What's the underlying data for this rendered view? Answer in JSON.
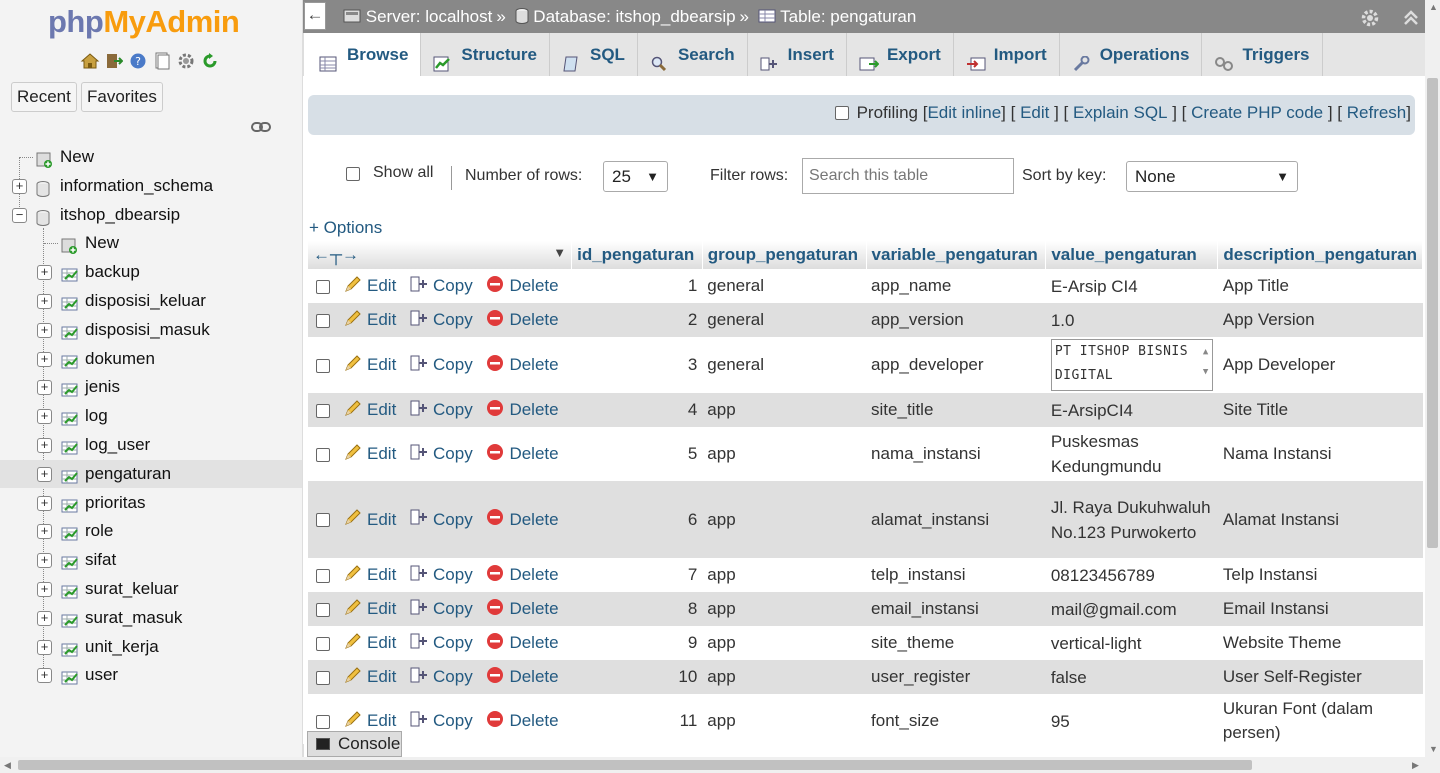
{
  "sidebar": {
    "logo_part1": "php",
    "logo_part2": "MyAdmin",
    "recent_label": "Recent",
    "favorites_label": "Favorites",
    "tree": [
      {
        "label": "New",
        "level": 0
      },
      {
        "label": "information_schema",
        "level": 0
      },
      {
        "label": "itshop_dbearsip",
        "level": 0
      },
      {
        "label": "New",
        "level": 1
      },
      {
        "label": "backup",
        "level": 1
      },
      {
        "label": "disposisi_keluar",
        "level": 1
      },
      {
        "label": "disposisi_masuk",
        "level": 1
      },
      {
        "label": "dokumen",
        "level": 1
      },
      {
        "label": "jenis",
        "level": 1
      },
      {
        "label": "log",
        "level": 1
      },
      {
        "label": "log_user",
        "level": 1
      },
      {
        "label": "pengaturan",
        "level": 1,
        "active": true
      },
      {
        "label": "prioritas",
        "level": 1
      },
      {
        "label": "role",
        "level": 1
      },
      {
        "label": "sifat",
        "level": 1
      },
      {
        "label": "surat_keluar",
        "level": 1
      },
      {
        "label": "surat_masuk",
        "level": 1
      },
      {
        "label": "unit_kerja",
        "level": 1
      },
      {
        "label": "user",
        "level": 1
      }
    ]
  },
  "breadcrumb": {
    "server": "Server: localhost",
    "database": "Database: itshop_dbearsip",
    "table": "Table: pengaturan",
    "sep": "»"
  },
  "tabs": [
    {
      "label": "Browse",
      "icon": "browse-icon",
      "active": true
    },
    {
      "label": "Structure",
      "icon": "structure-icon"
    },
    {
      "label": "SQL",
      "icon": "sql-icon"
    },
    {
      "label": "Search",
      "icon": "search-icon"
    },
    {
      "label": "Insert",
      "icon": "insert-icon"
    },
    {
      "label": "Export",
      "icon": "export-icon"
    },
    {
      "label": "Import",
      "icon": "import-icon"
    },
    {
      "label": "Operations",
      "icon": "operations-icon"
    },
    {
      "label": "Triggers",
      "icon": "triggers-icon"
    }
  ],
  "sqlbar": {
    "profiling": "Profiling",
    "links": [
      "Edit inline",
      "Edit",
      "Explain SQL",
      "Create PHP code",
      "Refresh"
    ]
  },
  "navbar": {
    "show_all": "Show all",
    "rows_label": "Number of rows:",
    "rows_value": "25",
    "filter_label": "Filter rows:",
    "filter_placeholder": "Search this table",
    "sort_label": "Sort by key:",
    "sort_value": "None"
  },
  "options_link": "+ Options",
  "table": {
    "columns": [
      "id_pengaturan",
      "group_pengaturan",
      "variable_pengaturan",
      "value_pengaturan",
      "description_pengaturan"
    ],
    "actions": {
      "edit": "Edit",
      "copy": "Copy",
      "delete": "Delete"
    },
    "rows": [
      {
        "id": "1",
        "group": "general",
        "variable": "app_name",
        "value": "E-Arsip CI4",
        "description": "App Title"
      },
      {
        "id": "2",
        "group": "general",
        "variable": "app_version",
        "value": "1.0",
        "description": "App Version"
      },
      {
        "id": "3",
        "group": "general",
        "variable": "app_developer",
        "value": "PT ITSHOP BISNIS DIGITAL",
        "description": "App Developer",
        "textarea": true
      },
      {
        "id": "4",
        "group": "app",
        "variable": "site_title",
        "value": "E-ArsipCI4",
        "description": "Site Title"
      },
      {
        "id": "5",
        "group": "app",
        "variable": "nama_instansi",
        "value": "Puskesmas Kedungmundu",
        "description": "Nama Instansi"
      },
      {
        "id": "6",
        "group": "app",
        "variable": "alamat_instansi",
        "value": "Jl. Raya Dukuhwaluh No.123 Purwokerto",
        "description": "Alamat Instansi"
      },
      {
        "id": "7",
        "group": "app",
        "variable": "telp_instansi",
        "value": "08123456789",
        "description": "Telp Instansi"
      },
      {
        "id": "8",
        "group": "app",
        "variable": "email_instansi",
        "value": "mail@gmail.com",
        "description": "Email Instansi"
      },
      {
        "id": "9",
        "group": "app",
        "variable": "site_theme",
        "value": "vertical-light",
        "description": "Website Theme"
      },
      {
        "id": "10",
        "group": "app",
        "variable": "user_register",
        "value": "false",
        "description": "User Self-Register"
      },
      {
        "id": "11",
        "group": "app",
        "variable": "font_size",
        "value": "95",
        "description": "Ukuran Font (dalam persen)"
      }
    ]
  },
  "console_label": "Console",
  "colors": {
    "link": "#235a81",
    "topbar": "#888888",
    "row_even": "#dfdfdf",
    "sidebar": "#f3f3f3"
  }
}
